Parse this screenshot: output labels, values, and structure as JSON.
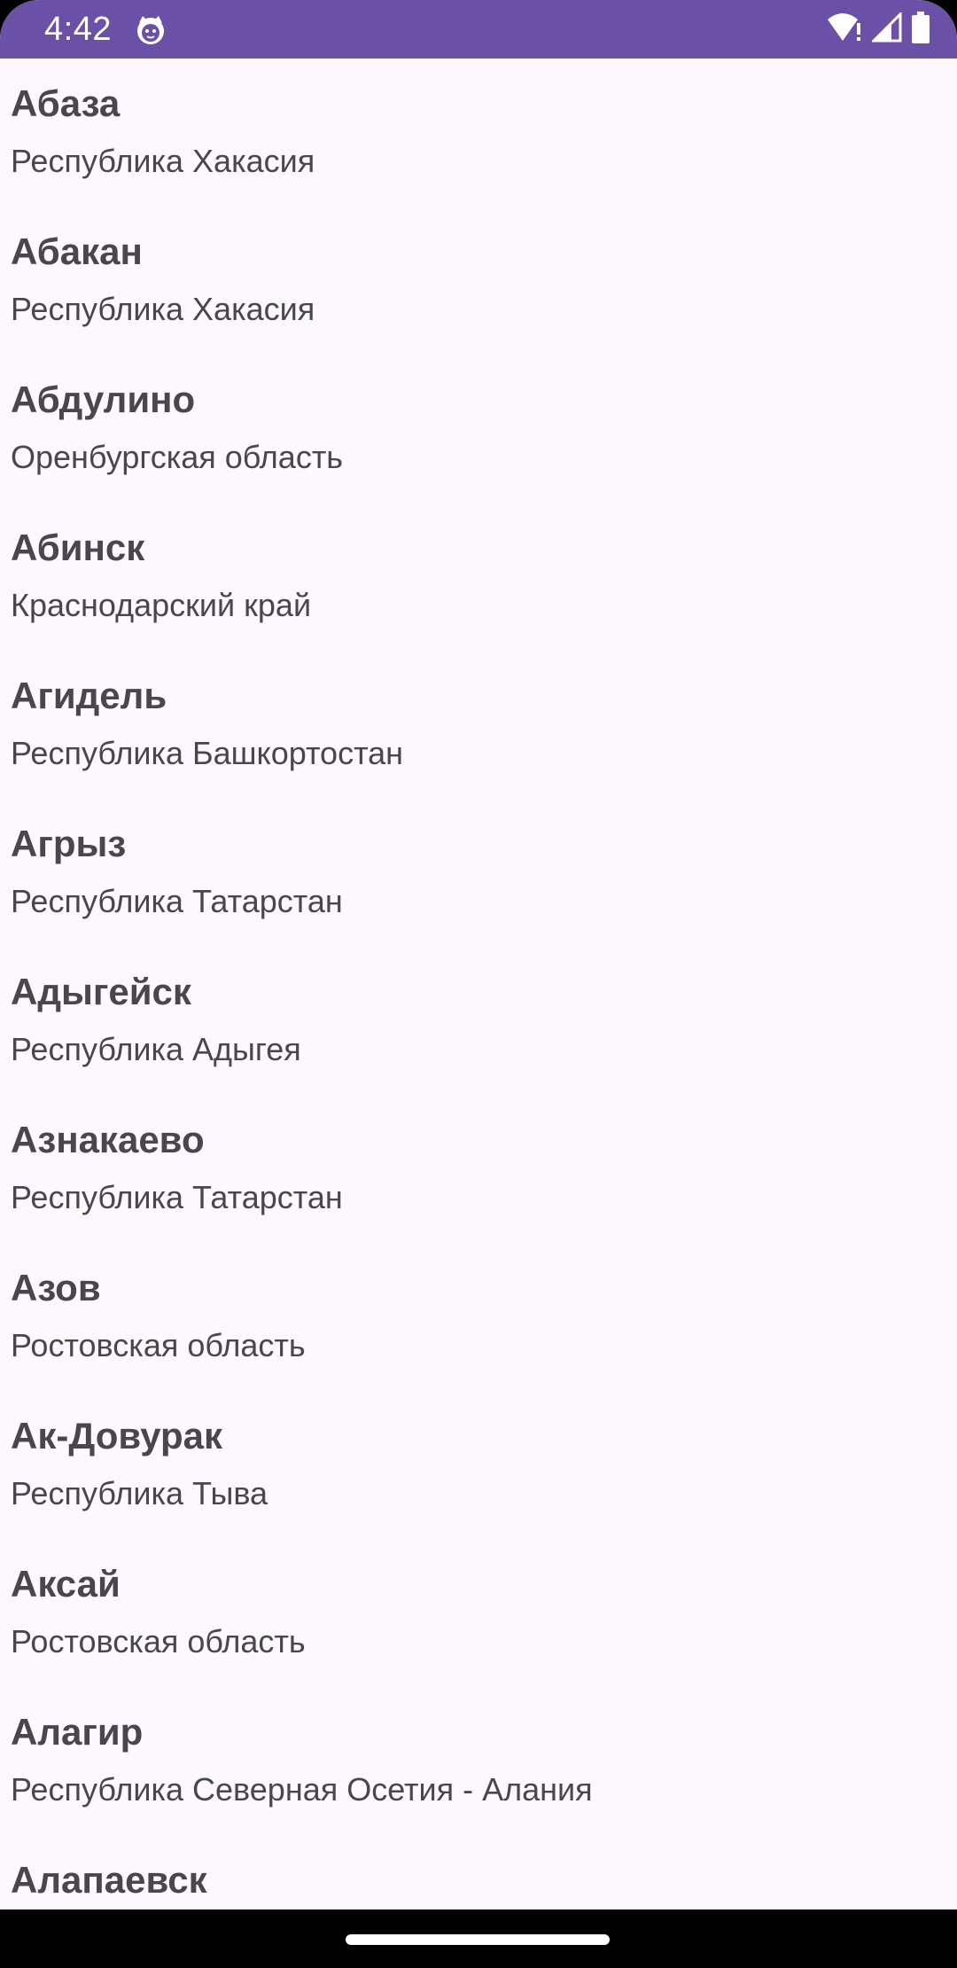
{
  "status_bar": {
    "time": "4:42",
    "app_icon": "cat-face-icon",
    "icons": [
      "wifi-alert-icon",
      "signal-icon",
      "battery-icon"
    ],
    "background_color": "#6A50A6"
  },
  "cities": [
    {
      "name": "Абаза",
      "region": "Республика Хакасия"
    },
    {
      "name": "Абакан",
      "region": "Республика Хакасия"
    },
    {
      "name": "Абдулино",
      "region": "Оренбургская область"
    },
    {
      "name": "Абинск",
      "region": "Краснодарский край"
    },
    {
      "name": "Агидель",
      "region": "Республика Башкортостан"
    },
    {
      "name": "Агрыз",
      "region": "Республика Татарстан"
    },
    {
      "name": "Адыгейск",
      "region": "Республика Адыгея"
    },
    {
      "name": "Азнакаево",
      "region": "Республика Татарстан"
    },
    {
      "name": "Азов",
      "region": "Ростовская область"
    },
    {
      "name": "Ак-Довурак",
      "region": "Республика Тыва"
    },
    {
      "name": "Аксай",
      "region": "Ростовская область"
    },
    {
      "name": "Алагир",
      "region": "Республика Северная Осетия - Алания"
    },
    {
      "name": "Алапаевск",
      "region": ""
    }
  ],
  "colors": {
    "background": "#FDF7FE",
    "text": "#4A454E",
    "nav_bar": "#000000"
  }
}
